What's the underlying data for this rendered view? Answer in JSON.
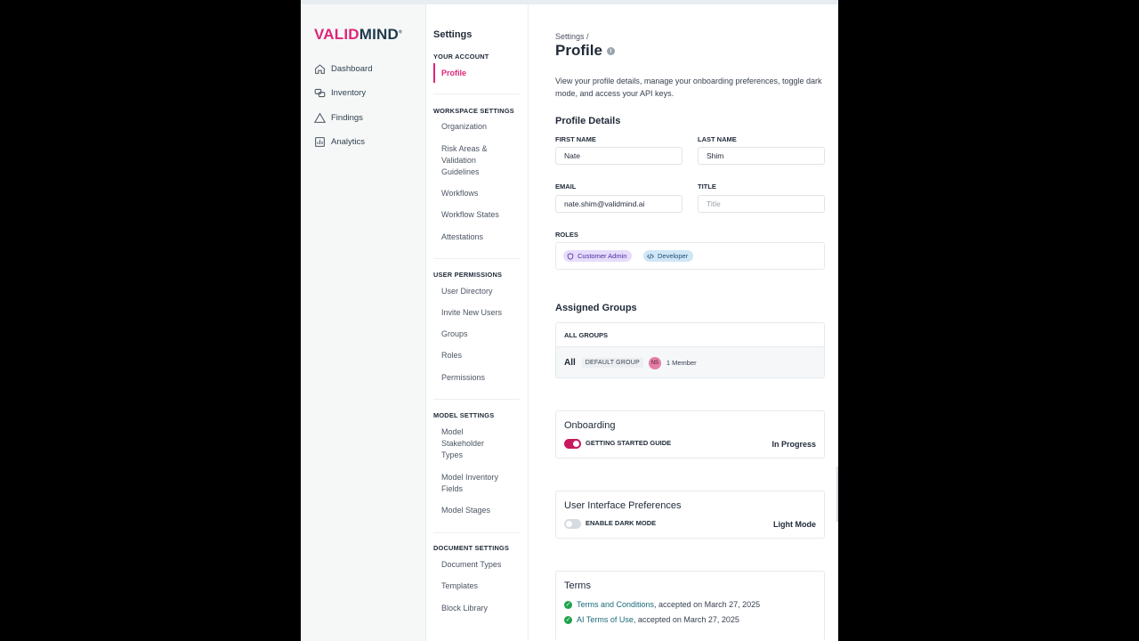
{
  "brand": {
    "logo_part1": "VALID",
    "logo_part2": "MIND",
    "logo_mark": "®"
  },
  "leftnav": {
    "items": [
      {
        "label": "Dashboard",
        "icon": "home-icon"
      },
      {
        "label": "Inventory",
        "icon": "inventory-icon"
      },
      {
        "label": "Findings",
        "icon": "warning-triangle-icon"
      },
      {
        "label": "Analytics",
        "icon": "chart-icon"
      }
    ]
  },
  "settings_nav": {
    "title": "Settings",
    "your_account": {
      "heading": "YOUR ACCOUNT",
      "items": [
        "Profile"
      ]
    },
    "workspace": {
      "heading": "WORKSPACE SETTINGS",
      "items": [
        "Organization",
        "Risk Areas & Validation Guidelines",
        "Workflows",
        "Workflow States",
        "Attestations"
      ]
    },
    "user_permissions": {
      "heading": "USER PERMISSIONS",
      "items": [
        "User Directory",
        "Invite New Users",
        "Groups",
        "Roles",
        "Permissions"
      ]
    },
    "model_settings": {
      "heading": "MODEL SETTINGS",
      "items": [
        "Model Stakeholder Types",
        "Model Inventory Fields",
        "Model Stages"
      ]
    },
    "document_settings": {
      "heading": "DOCUMENT SETTINGS",
      "items": [
        "Document Types",
        "Templates",
        "Block Library"
      ]
    }
  },
  "main": {
    "breadcrumb": "Settings  /",
    "title": "Profile",
    "info_glyph": "i",
    "intro": "View your profile details, manage your onboarding preferences, toggle dark mode, and access your API keys.",
    "profile_details": {
      "heading": "Profile Details",
      "first_name_label": "FIRST NAME",
      "first_name_value": "Nate",
      "last_name_label": "LAST NAME",
      "last_name_value": "Shim",
      "email_label": "EMAIL",
      "email_value": "nate.shim@validmind.ai",
      "title_label": "TITLE",
      "title_placeholder": "Title",
      "roles_label": "ROLES",
      "roles": [
        "Customer Admin",
        "Developer"
      ]
    },
    "assigned_groups": {
      "heading": "Assigned Groups",
      "table_header": "ALL GROUPS",
      "row": {
        "name": "All",
        "badge": "DEFAULT GROUP",
        "avatar": "NS",
        "members": "1 Member"
      }
    },
    "onboarding": {
      "heading": "Onboarding",
      "toggle_label": "GETTING STARTED GUIDE",
      "status": "In Progress",
      "toggle_on": true
    },
    "ui_prefs": {
      "heading": "User Interface Preferences",
      "toggle_label": "ENABLE DARK MODE",
      "status": "Light Mode",
      "toggle_on": false
    },
    "terms": {
      "heading": "Terms",
      "items": [
        {
          "link": "Terms and Conditions",
          "text": ", accepted on March 27, 2025"
        },
        {
          "link": "AI Terms of Use",
          "text": ", accepted on March 27, 2025"
        }
      ]
    }
  },
  "colors": {
    "accent": "#de2576",
    "brand_dark": "#1f3a4d",
    "link": "#1a6a7a",
    "success": "#1fa34a"
  }
}
